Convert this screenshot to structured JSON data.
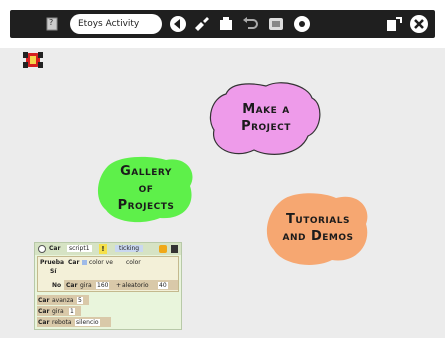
{
  "toolbar": {
    "stop_label": "?",
    "activity_name": "Etoys Activity",
    "icons": [
      "stop-icon",
      "back-icon",
      "paint-icon",
      "supplies-icon",
      "undo-icon",
      "project-icon",
      "navigator-icon",
      "share-icon",
      "close-icon"
    ]
  },
  "canvas": {
    "bubbles": [
      {
        "id": "make-project",
        "text": "Make a Project",
        "color": "#ee9bea"
      },
      {
        "id": "gallery",
        "text": "Gallery of Projects",
        "color": "#5ef04a"
      },
      {
        "id": "tutorials",
        "text": "Tutorials and Demos",
        "color": "#f6a771"
      }
    ]
  },
  "script": {
    "object_name": "Car",
    "script_name": "script1",
    "status": "ticking",
    "test_label": "Prueba",
    "yes_label": "Sí",
    "no_label": "No",
    "condition": {
      "object": "Car",
      "property": "color ve",
      "value": "color"
    },
    "no_action": {
      "object": "Car",
      "verb": "gira",
      "amount": "160",
      "op": "+",
      "func": "aleatorio",
      "arg": "40"
    },
    "lines": [
      {
        "object": "Car",
        "verb": "avanza",
        "amount": "5"
      },
      {
        "object": "Car",
        "verb": "gira",
        "amount": "1"
      },
      {
        "object": "Car",
        "verb": "rebota",
        "amount": "silencio"
      }
    ]
  }
}
